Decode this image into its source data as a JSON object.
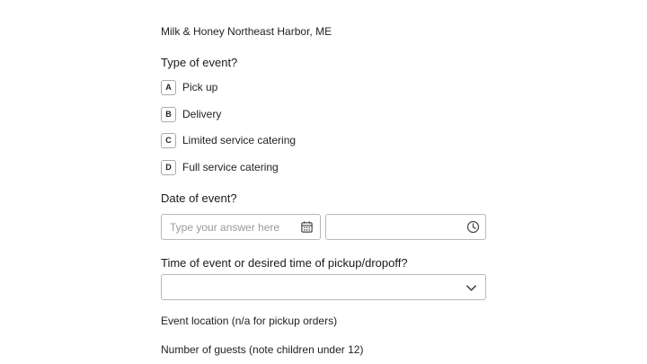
{
  "header": {
    "business": "Milk & Honey Northeast Harbor, ME"
  },
  "event_type": {
    "question": "Type of event?",
    "options": [
      {
        "key": "A",
        "label": "Pick up"
      },
      {
        "key": "B",
        "label": "Delivery"
      },
      {
        "key": "C",
        "label": "Limited service catering"
      },
      {
        "key": "D",
        "label": "Full service catering"
      }
    ]
  },
  "event_date": {
    "question": "Date of event?",
    "date_placeholder": "Type your answer here",
    "date_value": "",
    "time_value": "",
    "date_icon": "calendar-icon",
    "time_icon": "clock-icon"
  },
  "event_time": {
    "question": "Time of event or desired time of pickup/dropoff?",
    "selected_value": "",
    "dropdown_icon": "chevron-down-icon"
  },
  "location": {
    "label": "Event location (n/a for pickup orders)"
  },
  "guests": {
    "label": "Number of guests (note children under 12)"
  }
}
